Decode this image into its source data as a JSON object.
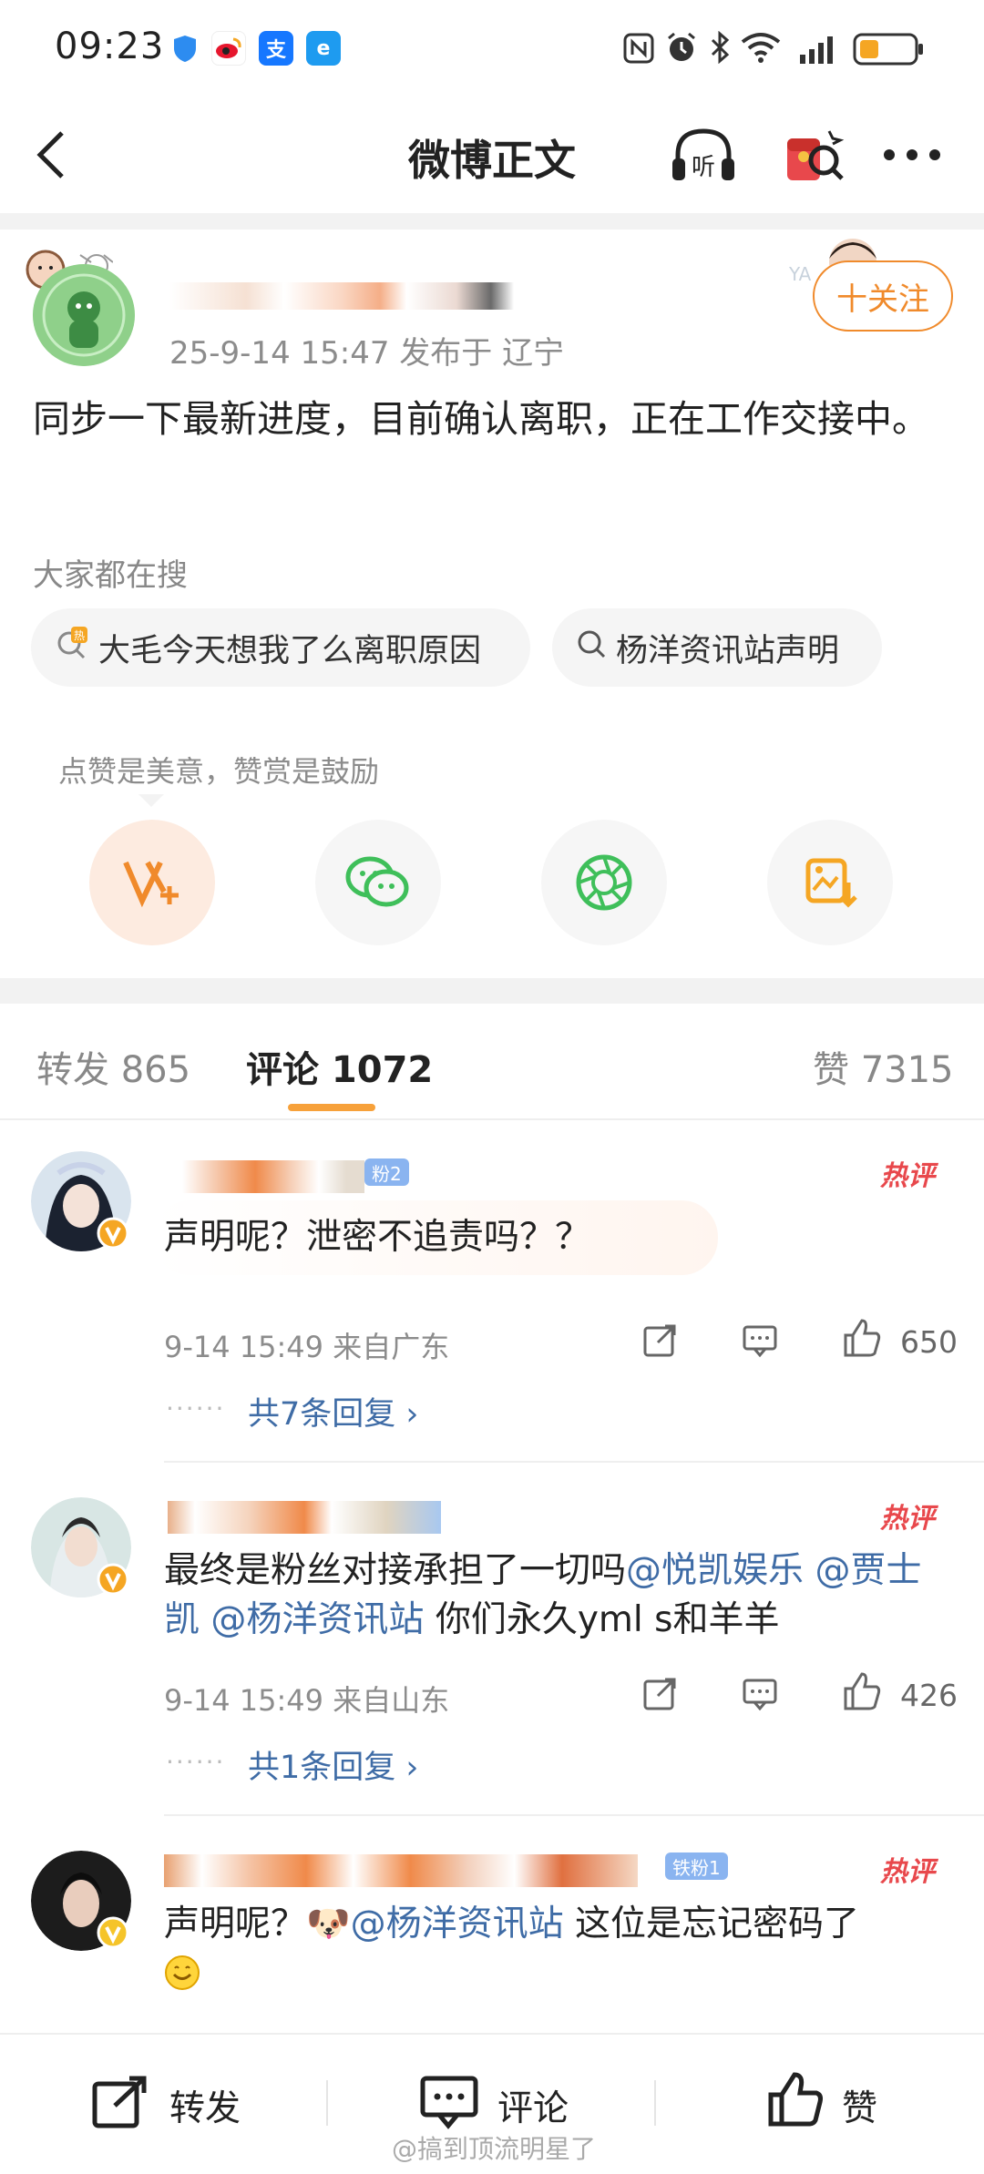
{
  "status_bar": {
    "time": "09:23"
  },
  "nav": {
    "title": "微博正文"
  },
  "post": {
    "meta": "25-9-14 15:47  发布于 辽宁",
    "follow_label": "十关注",
    "text": "同步一下最新进度，目前确认离职，正在工作交接中。"
  },
  "search": {
    "title": "大家都在搜",
    "chips": [
      "大毛今天想我了么离职原因",
      "杨洋资讯站声明"
    ]
  },
  "reward_tip": "点赞是美意，赞赏是鼓励",
  "tabs": {
    "repost": "转发 865",
    "comment": "评论 1072",
    "like": "赞 7315"
  },
  "comments": [
    {
      "badge": "粉2",
      "text": "声明呢？泄密不追责吗？？",
      "meta": "9-14 15:49 来自广东",
      "likes": "650",
      "replies": "共7条回复 ›",
      "hot": "热评"
    },
    {
      "badge": "",
      "text_before": "最终是粉丝对接承担了一切吗",
      "mention1": "@悦凯娱乐",
      "mention2": "@贾士凯",
      "mention3": "@杨洋资讯站",
      "text_after": " 你们永久yml s和羊羊",
      "meta": "9-14 15:49 来自山东",
      "likes": "426",
      "replies": "共1条回复 ›",
      "hot": "热评"
    },
    {
      "badge": "铁粉1",
      "text_before": "声明呢？",
      "mention": "@杨洋资讯站",
      "text_after": " 这位是忘记密码了",
      "hot": "热评"
    }
  ],
  "bottom_bar": {
    "repost": "转发",
    "comment": "评论",
    "like": "赞"
  },
  "watermark": "@搞到顶流明星了",
  "colors": {
    "accent": "#f08a2b",
    "link": "#3f6ca6",
    "hot": "#e8484c"
  }
}
